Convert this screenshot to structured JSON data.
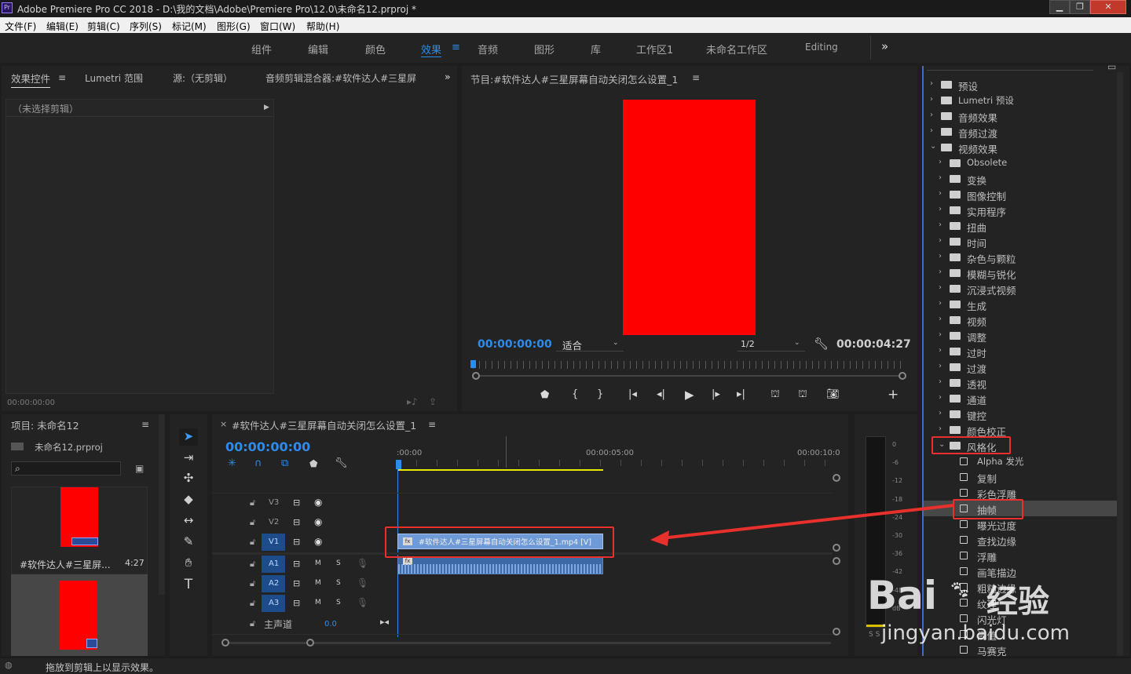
{
  "window": {
    "app_badge": "Pr",
    "title": "Adobe Premiere Pro CC 2018 - D:\\我的文档\\Adobe\\Premiere Pro\\12.0\\未命名12.prproj *"
  },
  "menu": [
    "文件(F)",
    "编辑(E)",
    "剪辑(C)",
    "序列(S)",
    "标记(M)",
    "图形(G)",
    "窗口(W)",
    "帮助(H)"
  ],
  "workspaces": [
    "组件",
    "编辑",
    "颜色",
    "效果",
    "音频",
    "图形",
    "库",
    "工作区1",
    "未命名工作区",
    "Editing"
  ],
  "workspaces_active": "效果",
  "source_panel": {
    "tabs": [
      "效果控件",
      "Lumetri 范围",
      "源:（无剪辑）",
      "音频剪辑混合器:#软件达人#三星屏"
    ],
    "no_clip": "（未选择剪辑）",
    "timecode": "00:00:00:00"
  },
  "program_monitor": {
    "title": "节目:#软件达人#三星屏幕自动关闭怎么设置_1",
    "timecode": "00:00:00:00",
    "fit": "适合",
    "resolution": "1/2",
    "duration": "00:00:04:27",
    "frame_color": "#ff0000"
  },
  "project": {
    "title": "项目: 未命名12",
    "file": "未命名12.prproj",
    "search_placeholder": "",
    "items": [
      {
        "name": "#软件达人#三星屏...",
        "duration": "4:27"
      },
      {
        "name": "",
        "duration": ""
      }
    ]
  },
  "timeline": {
    "title": "#软件达人#三星屏幕自动关闭怎么设置_1",
    "timecode": "00:00:00:00",
    "ruler": [
      ":00:00",
      "00:00:05:00",
      "00:00:10:0"
    ],
    "video_tracks": [
      "V3",
      "V2",
      "V1"
    ],
    "audio_tracks": [
      "A1",
      "A2",
      "A3"
    ],
    "track_m": "M",
    "track_s": "S",
    "master": "主声道",
    "master_value": "0.0",
    "clip_label": "#软件达人#三星屏幕自动关闭怎么设置_1.mp4 [V]",
    "fx_badge": "fx"
  },
  "meter": {
    "scale": [
      "0",
      "-6",
      "-12",
      "-18",
      "-24",
      "-30",
      "-36",
      "-42",
      "-48",
      "dB"
    ],
    "ss": "S S"
  },
  "effects": {
    "rows": [
      {
        "label": "预设",
        "level": 0,
        "type": "folder",
        "open": false
      },
      {
        "label": "Lumetri 预设",
        "level": 0,
        "type": "folder",
        "open": false
      },
      {
        "label": "音频效果",
        "level": 0,
        "type": "folder",
        "open": false
      },
      {
        "label": "音频过渡",
        "level": 0,
        "type": "folder",
        "open": false
      },
      {
        "label": "视频效果",
        "level": 0,
        "type": "folder",
        "open": true
      },
      {
        "label": "Obsolete",
        "level": 1,
        "type": "folder",
        "open": false
      },
      {
        "label": "变换",
        "level": 1,
        "type": "folder",
        "open": false
      },
      {
        "label": "图像控制",
        "level": 1,
        "type": "folder",
        "open": false
      },
      {
        "label": "实用程序",
        "level": 1,
        "type": "folder",
        "open": false
      },
      {
        "label": "扭曲",
        "level": 1,
        "type": "folder",
        "open": false
      },
      {
        "label": "时间",
        "level": 1,
        "type": "folder",
        "open": false
      },
      {
        "label": "杂色与颗粒",
        "level": 1,
        "type": "folder",
        "open": false
      },
      {
        "label": "模糊与锐化",
        "level": 1,
        "type": "folder",
        "open": false
      },
      {
        "label": "沉浸式视频",
        "level": 1,
        "type": "folder",
        "open": false
      },
      {
        "label": "生成",
        "level": 1,
        "type": "folder",
        "open": false
      },
      {
        "label": "视频",
        "level": 1,
        "type": "folder",
        "open": false
      },
      {
        "label": "调整",
        "level": 1,
        "type": "folder",
        "open": false
      },
      {
        "label": "过时",
        "level": 1,
        "type": "folder",
        "open": false
      },
      {
        "label": "过渡",
        "level": 1,
        "type": "folder",
        "open": false
      },
      {
        "label": "透视",
        "level": 1,
        "type": "folder",
        "open": false
      },
      {
        "label": "通道",
        "level": 1,
        "type": "folder",
        "open": false
      },
      {
        "label": "键控",
        "level": 1,
        "type": "folder",
        "open": false
      },
      {
        "label": "颜色校正",
        "level": 1,
        "type": "folder",
        "open": false
      },
      {
        "label": "风格化",
        "level": 1,
        "type": "folder",
        "open": true
      },
      {
        "label": "Alpha 发光",
        "level": 2,
        "type": "effect"
      },
      {
        "label": "复制",
        "level": 2,
        "type": "effect"
      },
      {
        "label": "彩色浮雕",
        "level": 2,
        "type": "effect"
      },
      {
        "label": "抽帧",
        "level": 2,
        "type": "effect",
        "selected": true
      },
      {
        "label": "曝光过度",
        "level": 2,
        "type": "effect"
      },
      {
        "label": "查找边缘",
        "level": 2,
        "type": "effect"
      },
      {
        "label": "浮雕",
        "level": 2,
        "type": "effect"
      },
      {
        "label": "画笔描边",
        "level": 2,
        "type": "effect"
      },
      {
        "label": "粗糙边缘",
        "level": 2,
        "type": "effect"
      },
      {
        "label": "纹理",
        "level": 2,
        "type": "effect"
      },
      {
        "label": "闪光灯",
        "level": 2,
        "type": "effect"
      },
      {
        "label": "阈值",
        "level": 2,
        "type": "effect"
      },
      {
        "label": "马赛克",
        "level": 2,
        "type": "effect"
      }
    ]
  },
  "status": "拖放到剪辑上以显示效果。",
  "watermark": {
    "brand": "Bai",
    "brand2": "经验",
    "url": "jingyan.baidu.com"
  },
  "colors": {
    "accent": "#2d8ceb",
    "annotation": "#e8302c",
    "clip_video": "#6f9ad8",
    "clip_audio": "#3e6aa8",
    "work_area": "#e8e800"
  }
}
